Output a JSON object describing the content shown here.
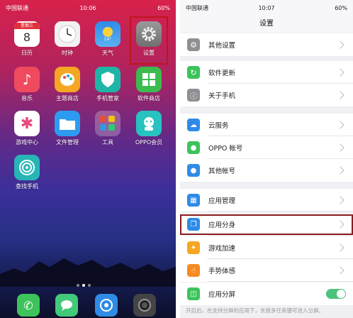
{
  "home": {
    "status": {
      "carrier": "中国联通",
      "time": "10:06",
      "battery": "60%"
    },
    "apps": [
      {
        "label": "日历",
        "icon": "calendar-icon",
        "sub": "星期三",
        "day": "8"
      },
      {
        "label": "时钟",
        "icon": "clock-icon"
      },
      {
        "label": "天气",
        "icon": "weather-icon",
        "temp": "14°"
      },
      {
        "label": "设置",
        "icon": "gear-icon"
      },
      {
        "label": "音乐",
        "icon": "music-icon"
      },
      {
        "label": "主题商店",
        "icon": "palette-icon"
      },
      {
        "label": "手机管家",
        "icon": "shield-icon"
      },
      {
        "label": "软件商店",
        "icon": "app-store-icon"
      },
      {
        "label": "游戏中心",
        "icon": "game-center-icon"
      },
      {
        "label": "文件管理",
        "icon": "folder-icon"
      },
      {
        "label": "工具",
        "icon": "tools-folder-icon"
      },
      {
        "label": "OPPO会员",
        "icon": "member-icon"
      },
      {
        "label": "查找手机",
        "icon": "find-phone-icon"
      }
    ],
    "dock": [
      {
        "icon": "phone-icon"
      },
      {
        "icon": "messages-icon"
      },
      {
        "icon": "browser-icon"
      },
      {
        "icon": "camera-icon"
      }
    ]
  },
  "settings": {
    "status": {
      "carrier": "中国联通",
      "time": "10:07",
      "battery": "60%"
    },
    "title": "设置",
    "rows": [
      {
        "label": "其他设置",
        "icon": "gear-icon"
      },
      {
        "label": "软件更新",
        "icon": "update-icon"
      },
      {
        "label": "关于手机",
        "icon": "info-icon"
      },
      {
        "label": "云服务",
        "icon": "cloud-icon"
      },
      {
        "label": "OPPO 帐号",
        "icon": "account-icon"
      },
      {
        "label": "其他帐号",
        "icon": "other-account-icon"
      },
      {
        "label": "应用管理",
        "icon": "app-management-icon"
      },
      {
        "label": "应用分身",
        "icon": "app-clone-icon"
      },
      {
        "label": "游戏加速",
        "icon": "game-boost-icon"
      },
      {
        "label": "手势体感",
        "icon": "gesture-icon"
      },
      {
        "label": "应用分屏",
        "icon": "split-screen-icon",
        "toggle": true
      }
    ],
    "footnote": "开启后，在支持分屏的应用下，长按多任务键可进入分屏。"
  },
  "colors": {
    "highlight": "#c0141c",
    "toggle_on": "#4cc27c"
  }
}
